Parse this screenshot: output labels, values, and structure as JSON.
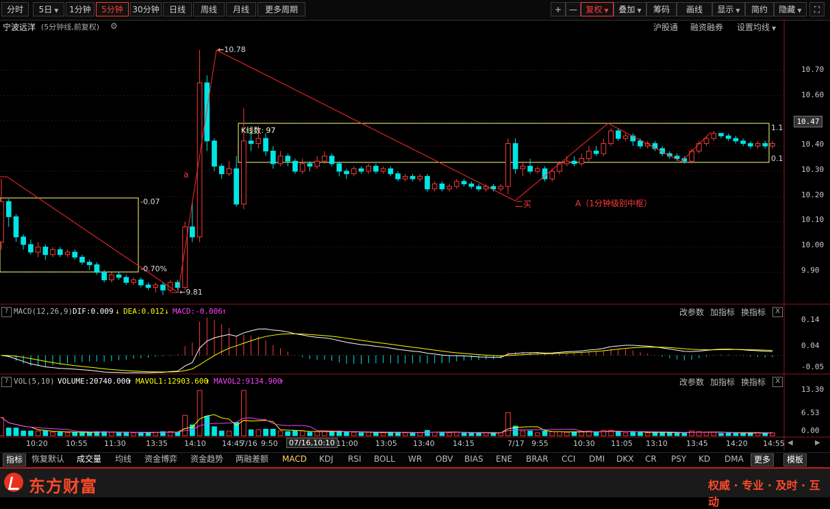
{
  "toolbar": {
    "periods": [
      "分时",
      "5日",
      "1分钟",
      "5分钟",
      "30分钟",
      "日线",
      "周线",
      "月线",
      "更多周期"
    ],
    "active_period": "5分钟",
    "plus": "+",
    "minus": "—",
    "fuquan": "复权",
    "overlay": "叠加",
    "chips": "筹码",
    "draw": "画线",
    "display": "显示",
    "brief": "简约",
    "hide": "隐藏",
    "fullscreen": "⛶"
  },
  "title": {
    "stock_name": "宁波远洋",
    "subtitle": "(5分钟线,前复权)",
    "links": [
      "沪股通",
      "融资融券",
      "设置均线"
    ]
  },
  "price_axis": [
    "10.70",
    "10.60",
    "10.50",
    "10.47",
    "10.40",
    "10.30",
    "10.20",
    "10.10",
    "10.00",
    "9.90"
  ],
  "annotations": {
    "high_label": "10.78",
    "low_label": "9.81",
    "box1_top": "0.07",
    "box1_bottom": "0.70%",
    "box2_title": "K线数: 97",
    "box2_top": "1.1",
    "box2_bottom": "0.1",
    "wave_a": "a",
    "buy2": "二买",
    "center_A": "A（1分钟级别中枢）"
  },
  "macd": {
    "label": "MACD(12,26,9)",
    "dif": "DIF:0.009",
    "dea": "DEA:0.012",
    "macd": "MACD:-0.006",
    "axis": [
      "0.14",
      "0.04",
      "-0.05"
    ]
  },
  "vol": {
    "label": "VOL(5,10)",
    "volume": "VOLUME:20740.000",
    "mavol1": "MAVOL1:12903.600",
    "mavol2": "MAVOL2:9134.900",
    "axis": [
      "13.30",
      "6.53",
      "0.00"
    ]
  },
  "panel_buttons": [
    "改参数",
    "加指标",
    "换指标"
  ],
  "panel_close": "X",
  "x_axis": [
    "10:20",
    "10:55",
    "11:30",
    "13:35",
    "14:10",
    "14:45",
    "7/16",
    "9:50",
    "07/16,10:10",
    "11:00",
    "13:05",
    "13:40",
    "14:15",
    "7/17",
    "9:55",
    "10:30",
    "11:05",
    "13:10",
    "13:45",
    "14:20",
    "14:55"
  ],
  "bottom_tabs": [
    "指标",
    "恢复默认",
    "成交量",
    "均线",
    "资金博弈",
    "资金趋势",
    "两融差额",
    "MACD",
    "KDJ",
    "RSI",
    "BOLL",
    "WR",
    "OBV",
    "BIAS",
    "ENE",
    "BRAR",
    "CCI",
    "DMI",
    "DKX",
    "CR",
    "PSY",
    "KD",
    "DMA",
    "更多",
    "模板"
  ],
  "brand": {
    "name": "东方财富",
    "slogan": "权威 · 专业 · 及时 · 互动"
  },
  "colors": {
    "up": "#ff3a3a",
    "down": "#00e5e5",
    "accent": "#ff3a3a",
    "box": "#ffff80",
    "dif": "#ffffff",
    "dea": "#ffff00",
    "mavol2": "#ff40ff"
  },
  "chart_data": {
    "type": "candlestick",
    "price_ylim": [
      9.82,
      10.78
    ],
    "candles": [
      [
        10.02,
        10.18,
        10.27,
        9.99
      ],
      [
        10.18,
        10.12,
        10.19,
        10.08
      ],
      [
        10.12,
        10.04,
        10.13,
        10.02
      ],
      [
        10.04,
        10.01,
        10.05,
        9.99
      ],
      [
        10.01,
        9.98,
        10.03,
        9.97
      ],
      [
        9.98,
        10.0,
        10.02,
        9.96
      ],
      [
        10.0,
        9.97,
        10.01,
        9.95
      ],
      [
        9.97,
        9.99,
        10.0,
        9.96
      ],
      [
        9.99,
        9.97,
        10.0,
        9.96
      ],
      [
        9.97,
        9.98,
        9.99,
        9.96
      ],
      [
        9.98,
        9.96,
        9.99,
        9.95
      ],
      [
        9.96,
        9.94,
        9.97,
        9.93
      ],
      [
        9.94,
        9.93,
        9.95,
        9.91
      ],
      [
        9.93,
        9.9,
        9.94,
        9.89
      ],
      [
        9.9,
        9.87,
        9.91,
        9.86
      ],
      [
        9.87,
        9.89,
        9.9,
        9.86
      ],
      [
        9.89,
        9.88,
        9.9,
        9.87
      ],
      [
        9.88,
        9.86,
        9.89,
        9.85
      ],
      [
        9.86,
        9.87,
        9.88,
        9.85
      ],
      [
        9.87,
        9.85,
        9.88,
        9.84
      ],
      [
        9.85,
        9.84,
        9.86,
        9.83
      ],
      [
        9.84,
        9.85,
        9.86,
        9.82
      ],
      [
        9.85,
        9.83,
        9.86,
        9.81
      ],
      [
        9.83,
        9.86,
        9.87,
        9.82
      ],
      [
        9.86,
        9.84,
        9.87,
        9.83
      ],
      [
        9.84,
        10.08,
        10.1,
        9.83
      ],
      [
        10.08,
        10.04,
        10.18,
        10.02
      ],
      [
        10.04,
        10.65,
        10.78,
        10.02
      ],
      [
        10.65,
        10.42,
        10.68,
        10.38
      ],
      [
        10.42,
        10.32,
        10.43,
        10.3
      ],
      [
        10.32,
        10.29,
        10.33,
        10.27
      ],
      [
        10.29,
        10.31,
        10.34,
        10.28
      ],
      [
        10.31,
        10.17,
        10.36,
        10.16
      ],
      [
        10.17,
        10.42,
        10.55,
        10.15
      ],
      [
        10.42,
        10.41,
        10.46,
        10.38
      ],
      [
        10.41,
        10.43,
        10.47,
        10.39
      ],
      [
        10.43,
        10.38,
        10.45,
        10.36
      ],
      [
        10.38,
        10.33,
        10.4,
        10.31
      ],
      [
        10.33,
        10.36,
        10.38,
        10.32
      ],
      [
        10.36,
        10.34,
        10.37,
        10.32
      ],
      [
        10.34,
        10.3,
        10.35,
        10.29
      ],
      [
        10.3,
        10.33,
        10.35,
        10.29
      ],
      [
        10.33,
        10.32,
        10.34,
        10.3
      ],
      [
        10.32,
        10.34,
        10.36,
        10.31
      ],
      [
        10.34,
        10.36,
        10.38,
        10.33
      ],
      [
        10.36,
        10.33,
        10.37,
        10.32
      ],
      [
        10.33,
        10.3,
        10.34,
        10.28
      ],
      [
        10.3,
        10.29,
        10.31,
        10.27
      ],
      [
        10.29,
        10.31,
        10.32,
        10.28
      ],
      [
        10.31,
        10.3,
        10.32,
        10.29
      ],
      [
        10.3,
        10.32,
        10.33,
        10.29
      ],
      [
        10.32,
        10.3,
        10.33,
        10.29
      ],
      [
        10.3,
        10.31,
        10.32,
        10.29
      ],
      [
        10.31,
        10.29,
        10.32,
        10.28
      ],
      [
        10.29,
        10.27,
        10.3,
        10.26
      ],
      [
        10.27,
        10.28,
        10.29,
        10.26
      ],
      [
        10.28,
        10.27,
        10.29,
        10.26
      ],
      [
        10.27,
        10.28,
        10.29,
        10.26
      ],
      [
        10.28,
        10.23,
        10.29,
        10.22
      ],
      [
        10.23,
        10.25,
        10.26,
        10.22
      ],
      [
        10.25,
        10.23,
        10.26,
        10.22
      ],
      [
        10.23,
        10.24,
        10.25,
        10.22
      ],
      [
        10.24,
        10.26,
        10.27,
        10.23
      ],
      [
        10.26,
        10.25,
        10.27,
        10.24
      ],
      [
        10.25,
        10.24,
        10.26,
        10.23
      ],
      [
        10.24,
        10.23,
        10.25,
        10.22
      ],
      [
        10.23,
        10.24,
        10.25,
        10.22
      ],
      [
        10.24,
        10.23,
        10.25,
        10.22
      ],
      [
        10.23,
        10.24,
        10.25,
        10.22
      ],
      [
        10.24,
        10.41,
        10.43,
        10.21
      ],
      [
        10.41,
        10.31,
        10.43,
        10.29
      ],
      [
        10.31,
        10.32,
        10.34,
        10.28
      ],
      [
        10.32,
        10.3,
        10.35,
        10.29
      ],
      [
        10.3,
        10.31,
        10.32,
        10.29
      ],
      [
        10.31,
        10.27,
        10.32,
        10.26
      ],
      [
        10.27,
        10.3,
        10.31,
        10.26
      ],
      [
        10.3,
        10.33,
        10.34,
        10.29
      ],
      [
        10.33,
        10.34,
        10.36,
        10.32
      ],
      [
        10.34,
        10.33,
        10.36,
        10.32
      ],
      [
        10.33,
        10.35,
        10.37,
        10.32
      ],
      [
        10.35,
        10.38,
        10.4,
        10.34
      ],
      [
        10.38,
        10.37,
        10.4,
        10.36
      ],
      [
        10.37,
        10.41,
        10.43,
        10.36
      ],
      [
        10.41,
        10.46,
        10.47,
        10.4
      ],
      [
        10.46,
        10.43,
        10.47,
        10.42
      ],
      [
        10.43,
        10.44,
        10.45,
        10.42
      ],
      [
        10.44,
        10.42,
        10.45,
        10.4
      ],
      [
        10.42,
        10.4,
        10.43,
        10.39
      ],
      [
        10.4,
        10.41,
        10.42,
        10.39
      ],
      [
        10.41,
        10.39,
        10.42,
        10.38
      ],
      [
        10.39,
        10.37,
        10.4,
        10.36
      ],
      [
        10.37,
        10.36,
        10.38,
        10.35
      ],
      [
        10.36,
        10.35,
        10.37,
        10.34
      ],
      [
        10.35,
        10.34,
        10.36,
        10.33
      ],
      [
        10.34,
        10.38,
        10.39,
        10.33
      ],
      [
        10.38,
        10.41,
        10.42,
        10.37
      ],
      [
        10.41,
        10.43,
        10.44,
        10.4
      ],
      [
        10.43,
        10.45,
        10.46,
        10.42
      ],
      [
        10.45,
        10.44,
        10.45,
        10.43
      ],
      [
        10.44,
        10.43,
        10.45,
        10.42
      ],
      [
        10.43,
        10.42,
        10.44,
        10.41
      ],
      [
        10.42,
        10.41,
        10.43,
        10.4
      ],
      [
        10.41,
        10.4,
        10.42,
        10.39
      ],
      [
        10.4,
        10.41,
        10.42,
        10.39
      ],
      [
        10.41,
        10.4,
        10.42,
        10.39
      ],
      [
        10.4,
        10.41,
        10.42,
        10.39
      ]
    ],
    "macd_ylim": [
      -0.06,
      0.16
    ]
  }
}
